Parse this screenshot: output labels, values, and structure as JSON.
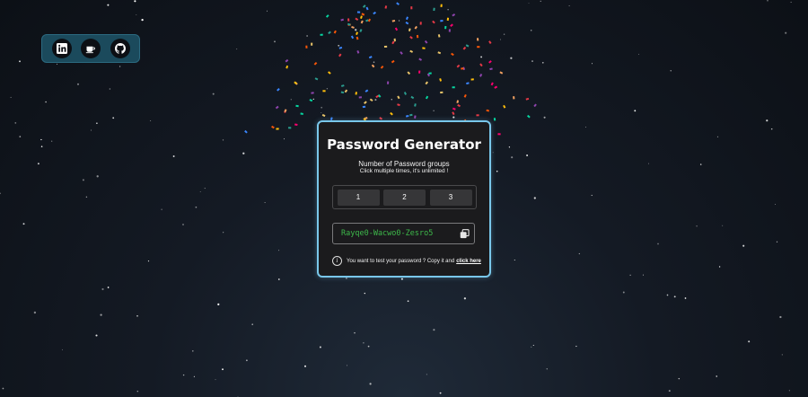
{
  "social": [
    {
      "name": "linkedin-icon",
      "label": "in"
    },
    {
      "name": "coffee-icon",
      "label": "coffee"
    },
    {
      "name": "github-icon",
      "label": "github"
    }
  ],
  "card": {
    "title": "Password Generator",
    "subtitle": "Number of Password groups",
    "hint": "Click multiple times, it's unlimited !",
    "groups": [
      "1",
      "2",
      "3"
    ],
    "password": "Rayqe0-Wacwo0-Zesro5",
    "footer_text": "You want to test your password ? Copy it and",
    "footer_link": "click here"
  },
  "colors": {
    "accent_border": "#79c7ea",
    "password_text": "#3db84a",
    "card_bg": "#1b1b1d",
    "social_bg": "#1b4a5c"
  }
}
